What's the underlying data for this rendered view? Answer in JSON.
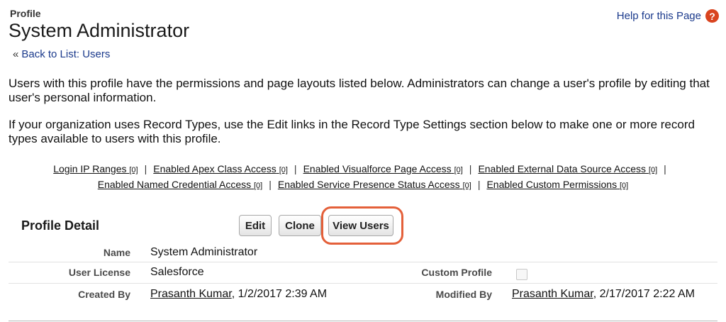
{
  "header": {
    "object_type": "Profile",
    "title": "System Administrator",
    "help_link": "Help for this Page",
    "help_icon": "?",
    "back_link": "Back to List: Users"
  },
  "description": [
    "Users with this profile have the permissions and page layouts listed below. Administrators can change a user's profile by editing that user's personal information.",
    "If your organization uses Record Types, use the Edit links in the Record Type Settings section below to make one or more record types available to users with this profile."
  ],
  "related_links": [
    {
      "label": "Login IP Ranges",
      "count": "[0]"
    },
    {
      "label": "Enabled Apex Class Access",
      "count": "[0]"
    },
    {
      "label": "Enabled Visualforce Page Access",
      "count": "[0]"
    },
    {
      "label": "Enabled External Data Source Access",
      "count": "[0]"
    },
    {
      "label": "Enabled Named Credential Access",
      "count": "[0]"
    },
    {
      "label": "Enabled Service Presence Status Access",
      "count": "[0]"
    },
    {
      "label": "Enabled Custom Permissions",
      "count": "[0]"
    }
  ],
  "separator": "|",
  "detail": {
    "section_title": "Profile Detail",
    "buttons": {
      "edit": "Edit",
      "clone": "Clone",
      "view_users": "View Users"
    },
    "fields": {
      "name_label": "Name",
      "name_value": "System Administrator",
      "user_license_label": "User License",
      "user_license_value": "Salesforce",
      "custom_profile_label": "Custom Profile",
      "custom_profile_checked": false,
      "created_by_label": "Created By",
      "created_by_user": "Prasanth Kumar",
      "created_by_date": ", 1/2/2017 2:39 AM",
      "modified_by_label": "Modified By",
      "modified_by_user": "Prasanth Kumar",
      "modified_by_date": ", 2/17/2017 2:22 AM"
    }
  },
  "colors": {
    "highlight": "#e4603a",
    "help_icon": "#d9441f",
    "link": "#1b3a8c"
  }
}
